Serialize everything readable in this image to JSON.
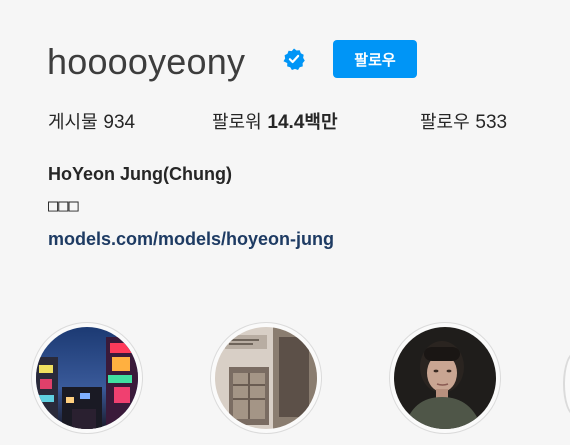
{
  "profile": {
    "username": "hooooyeony",
    "verified_icon": "verified-badge-icon",
    "follow_label": "팔로우",
    "accent_color": "#0095f6"
  },
  "stats": {
    "posts_label": "게시물",
    "posts_value": "934",
    "followers_label": "팔로워",
    "followers_value": "14.4",
    "followers_unit": "백만",
    "following_label": "팔로우",
    "following_value": "533"
  },
  "bio": {
    "full_name": "HoYeon Jung(Chung)",
    "text": "□□□",
    "link": "models.com/models/hoyeon-jung"
  },
  "highlights": [
    {
      "thumbnail": "city-night-photo"
    },
    {
      "thumbnail": "room-photo"
    },
    {
      "thumbnail": "portrait-photo"
    }
  ]
}
